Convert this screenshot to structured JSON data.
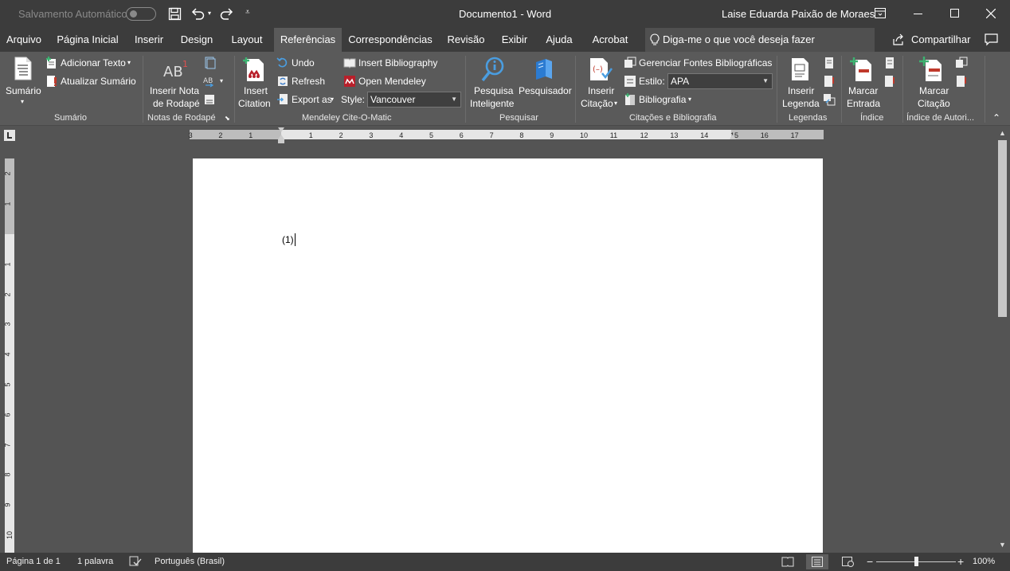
{
  "titlebar": {
    "autosave_label": "Salvamento Automático",
    "doc_title": "Documento1 - Word",
    "user_name": "Laise Eduarda Paixão de Moraes"
  },
  "tabs": [
    {
      "label": "Arquivo"
    },
    {
      "label": "Página Inicial"
    },
    {
      "label": "Inserir"
    },
    {
      "label": "Design"
    },
    {
      "label": "Layout"
    },
    {
      "label": "Referências"
    },
    {
      "label": "Correspondências"
    },
    {
      "label": "Revisão"
    },
    {
      "label": "Exibir"
    },
    {
      "label": "Ajuda"
    },
    {
      "label": "Acrobat"
    }
  ],
  "tellme_placeholder": "Diga-me o que você deseja fazer",
  "share_label": "Compartilhar",
  "ribbon": {
    "sumario": {
      "group": "Sumário",
      "sumario_btn": "Sumário",
      "adicionar_texto": "Adicionar Texto",
      "atualizar_sumario": "Atualizar Sumário"
    },
    "notas": {
      "group": "Notas de Rodapé",
      "inserir_nota_1": "Inserir Nota",
      "inserir_nota_2": "de Rodapé"
    },
    "mendeley": {
      "group": "Mendeley Cite-O-Matic",
      "insert_citation_1": "Insert",
      "insert_citation_2": "Citation",
      "undo": "Undo",
      "refresh": "Refresh",
      "export_as": "Export as",
      "insert_bibliography": "Insert Bibliography",
      "open_mendeley": "Open Mendeley",
      "style_label": "Style:",
      "style_value": "Vancouver"
    },
    "pesquisar": {
      "group": "Pesquisar",
      "pesquisa_1": "Pesquisa",
      "pesquisa_2": "Inteligente",
      "pesquisador": "Pesquisador"
    },
    "citacoes": {
      "group": "Citações e Bibliografia",
      "inserir_1": "Inserir",
      "inserir_2": "Citação",
      "gerenciar": "Gerenciar Fontes Bibliográficas",
      "estilo_label": "Estilo:",
      "estilo_value": "APA",
      "bibliografia": "Bibliografia"
    },
    "legendas": {
      "group": "Legendas",
      "inserir_1": "Inserir",
      "inserir_2": "Legenda"
    },
    "indice": {
      "group": "Índice",
      "marcar_1": "Marcar",
      "marcar_2": "Entrada"
    },
    "autoridades": {
      "group": "Índice de Autori...",
      "marcar_1": "Marcar",
      "marcar_2": "Citação"
    }
  },
  "ruler": {
    "h_numbers": [
      "3",
      "2",
      "1",
      "1",
      "2",
      "3",
      "4",
      "5",
      "6",
      "7",
      "8",
      "9",
      "10",
      "11",
      "12",
      "13",
      "14",
      "15",
      "16",
      "17"
    ],
    "v_numbers": [
      "2",
      "1",
      "1",
      "2",
      "3",
      "4",
      "5",
      "6",
      "7",
      "8",
      "9",
      "10"
    ]
  },
  "document": {
    "text": "(1)"
  },
  "status": {
    "page": "Página 1 de 1",
    "words": "1 palavra",
    "language": "Português (Brasil)",
    "zoom": "100%",
    "zoom_level": 1.0
  },
  "colors": {
    "accent_red": "#c0392b",
    "mendeley_red": "#b81f2a",
    "icon_blue": "#4a9de0"
  }
}
